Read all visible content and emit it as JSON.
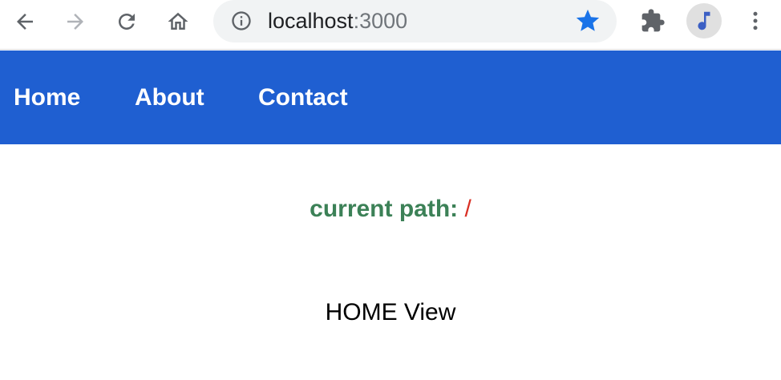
{
  "browser": {
    "url_host": "localhost",
    "url_port": ":3000",
    "icons": {
      "back": "back-arrow-icon",
      "forward": "forward-arrow-icon",
      "reload": "reload-icon",
      "home": "home-icon",
      "info": "info-icon",
      "bookmark": "star-icon",
      "extensions": "puzzle-icon",
      "profile": "music-note-avatar-icon",
      "menu": "kebab-menu-icon"
    },
    "colors": {
      "star": "#1a73e8",
      "forward_disabled": "#b0b3b8"
    }
  },
  "nav": {
    "items": [
      {
        "label": "Home"
      },
      {
        "label": "About"
      },
      {
        "label": "Contact"
      }
    ],
    "background": "#1f5fd1"
  },
  "main": {
    "current_path_label": "current path:",
    "current_path_value": "/",
    "view_text": "HOME View",
    "colors": {
      "label": "#3c8157",
      "value": "#d93025"
    }
  }
}
